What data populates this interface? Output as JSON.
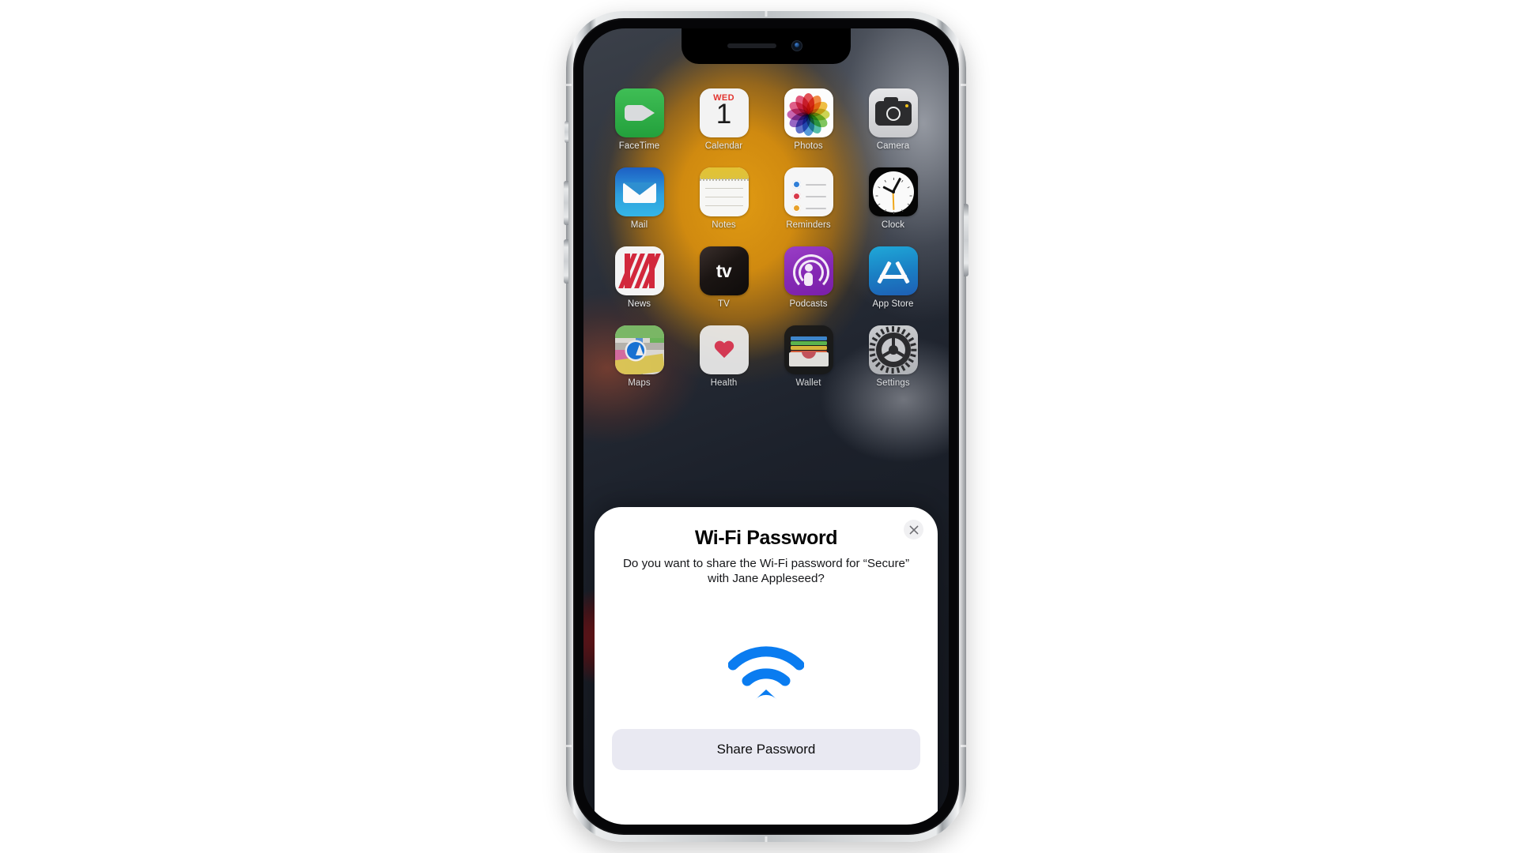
{
  "device": {
    "name": "iPhone",
    "notch": {
      "speaker": "earpiece-speaker",
      "camera": "front-camera"
    },
    "buttons": [
      {
        "name": "mute-switch"
      },
      {
        "name": "volume-up-button"
      },
      {
        "name": "volume-down-button"
      },
      {
        "name": "power-button"
      }
    ]
  },
  "home_screen": {
    "apps": [
      {
        "label": "FaceTime",
        "icon": "facetime-icon"
      },
      {
        "label": "Calendar",
        "icon": "calendar-icon",
        "day_of_week": "WED",
        "day": "1"
      },
      {
        "label": "Photos",
        "icon": "photos-icon"
      },
      {
        "label": "Camera",
        "icon": "camera-icon"
      },
      {
        "label": "Mail",
        "icon": "mail-icon"
      },
      {
        "label": "Notes",
        "icon": "notes-icon"
      },
      {
        "label": "Reminders",
        "icon": "reminders-icon"
      },
      {
        "label": "Clock",
        "icon": "clock-icon"
      },
      {
        "label": "News",
        "icon": "news-icon"
      },
      {
        "label": "TV",
        "icon": "tv-icon",
        "glyph": "tv"
      },
      {
        "label": "Podcasts",
        "icon": "podcasts-icon"
      },
      {
        "label": "App Store",
        "icon": "app-store-icon"
      },
      {
        "label": "Maps",
        "icon": "maps-icon"
      },
      {
        "label": "Health",
        "icon": "health-icon"
      },
      {
        "label": "Wallet",
        "icon": "wallet-icon"
      },
      {
        "label": "Settings",
        "icon": "settings-icon"
      }
    ]
  },
  "sheet": {
    "title": "Wi-Fi Password",
    "message": "Do you want to share the Wi-Fi password for “Secure” with Jane Appleseed?",
    "network_name": "Secure",
    "contact_name": "Jane Appleseed",
    "close_icon": "close-icon",
    "wifi_icon": "wifi-icon",
    "wifi_icon_color": "#0a7cf0",
    "share_label": "Share Password",
    "share_button_color": "#e9e9f2"
  }
}
